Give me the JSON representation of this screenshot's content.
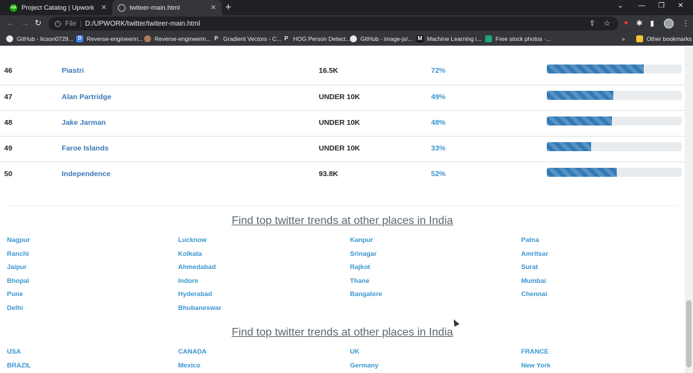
{
  "browser": {
    "tabs": [
      {
        "title": "Project Catalog | Upwork",
        "favicon": "upwork-icon",
        "active": false
      },
      {
        "title": "twiteer-main.html",
        "favicon": "globe-icon",
        "active": true
      }
    ],
    "address": {
      "scheme": "File",
      "url": "D:/UPWORK/twitter/twiteer-main.html"
    },
    "bookmarks": [
      {
        "label": "GitHub - licson0729...",
        "icon": "github-icon"
      },
      {
        "label": "Reverse-engineerin...",
        "icon": "d-icon"
      },
      {
        "label": "Reverse-engineerin...",
        "icon": "user-icon"
      },
      {
        "label": "Gradient Vectors - C...",
        "icon": "p-icon"
      },
      {
        "label": "HOG Person Detect...",
        "icon": "p-icon"
      },
      {
        "label": "GitHub - image-js/...",
        "icon": "github-icon"
      },
      {
        "label": "Machine Learning i...",
        "icon": "m-icon"
      },
      {
        "label": "Free stock photos ·...",
        "icon": "photo-icon"
      }
    ],
    "other_bookmarks": "Other bookmarks",
    "overflow": "»"
  },
  "trends": [
    {
      "rank": "46",
      "name": "Piastri",
      "volume": "16.5K",
      "percent": "72%",
      "fill": 72
    },
    {
      "rank": "47",
      "name": "Alan Partridge",
      "volume": "UNDER 10K",
      "percent": "49%",
      "fill": 49
    },
    {
      "rank": "48",
      "name": "Jake Jarman",
      "volume": "UNDER 10K",
      "percent": "48%",
      "fill": 48
    },
    {
      "rank": "49",
      "name": "Faroe Islands",
      "volume": "UNDER 10K",
      "percent": "33%",
      "fill": 33
    },
    {
      "rank": "50",
      "name": "Independence",
      "volume": "93.8K",
      "percent": "52%",
      "fill": 52
    }
  ],
  "sections": [
    {
      "title": "Find top twitter trends at other places in India",
      "places": [
        "Nagpur",
        "Lucknow",
        "Kanpur",
        "Patna",
        "Ranchi",
        "Kolkata",
        "Srinagar",
        "Amritsar",
        "Jaipur",
        "Ahmedabad",
        "Rajkot",
        "Surat",
        "Bhopal",
        "Indore",
        "Thane",
        "Mumbai",
        "Pune",
        "Hyderabad",
        "Bangalore",
        "Chennai",
        "Delhi",
        "Bhubaneswar"
      ]
    },
    {
      "title": "Find top twitter trends at other places in India",
      "places": [
        "USA",
        "CANADA",
        "UK",
        "FRANCE",
        "BRAZIL",
        "Mexico",
        "Germany",
        "New York"
      ]
    }
  ],
  "colors": {
    "accent": "#3b96d0",
    "bar": "#337ab7",
    "name_link": "#3b79b7"
  }
}
